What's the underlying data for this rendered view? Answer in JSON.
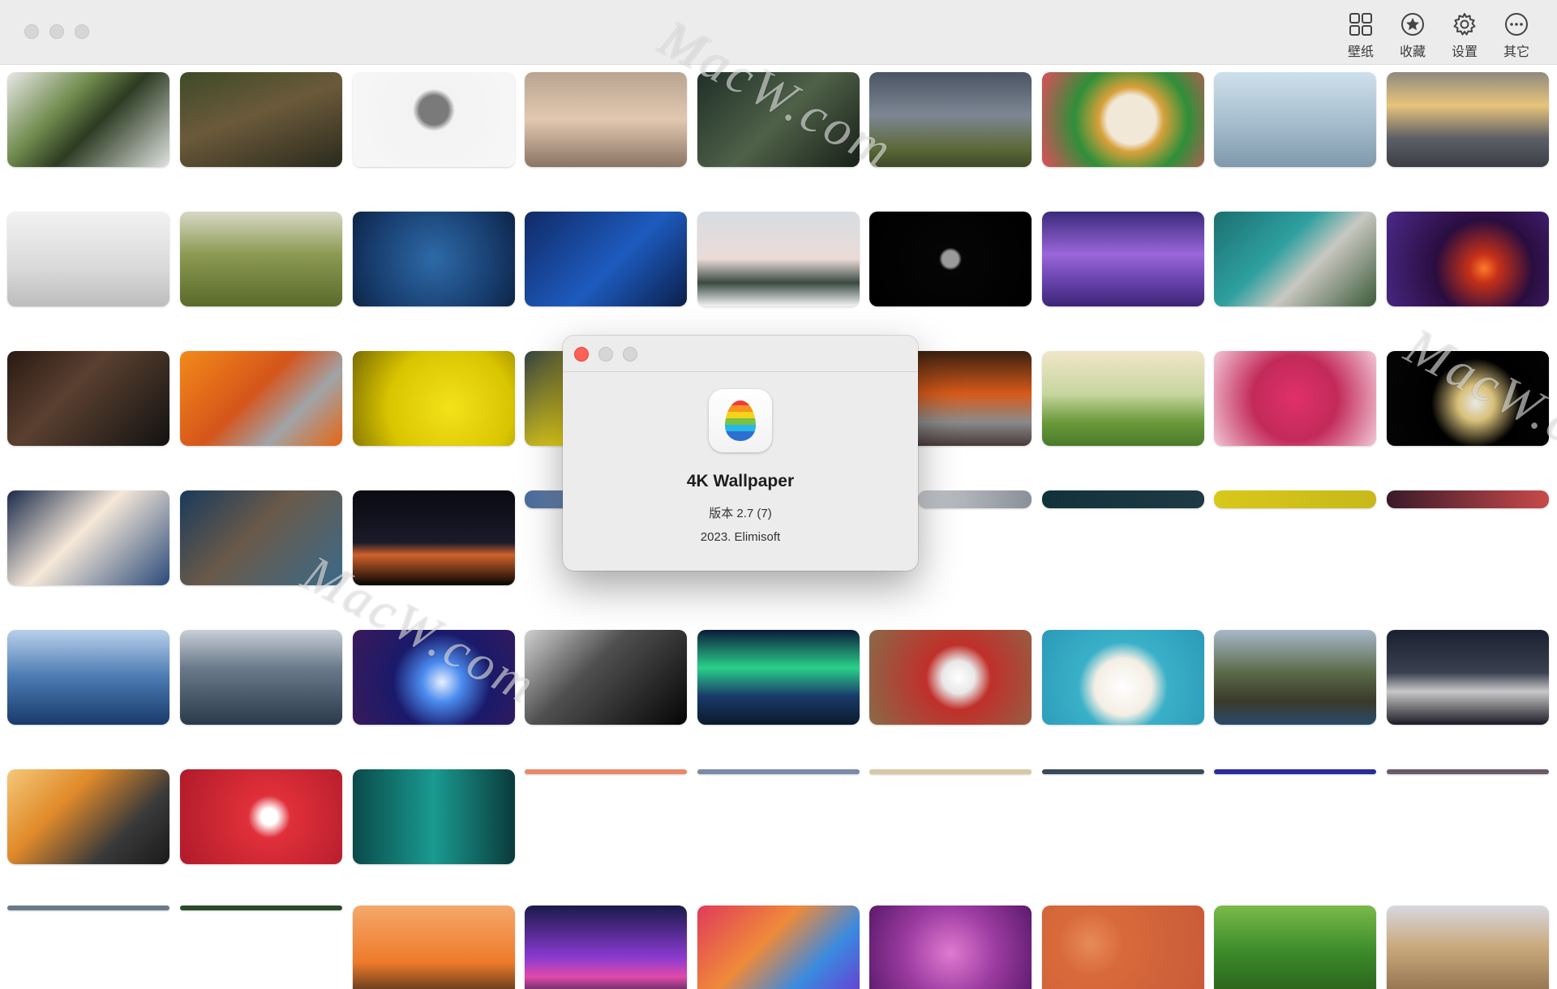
{
  "toolbar": {
    "items": [
      {
        "label": "壁纸",
        "icon": "grid-icon"
      },
      {
        "label": "收藏",
        "icon": "star-icon"
      },
      {
        "label": "设置",
        "icon": "gear-icon"
      },
      {
        "label": "其它",
        "icon": "more-icon"
      }
    ]
  },
  "watermark": "MacW.com",
  "about": {
    "app_name": "4K Wallpaper",
    "version": "版本 2.7 (7)",
    "copyright": "2023. Elimisoft"
  },
  "colors": {
    "close_red": "#fe5f57",
    "dim_gray": "#d6d6d6"
  }
}
